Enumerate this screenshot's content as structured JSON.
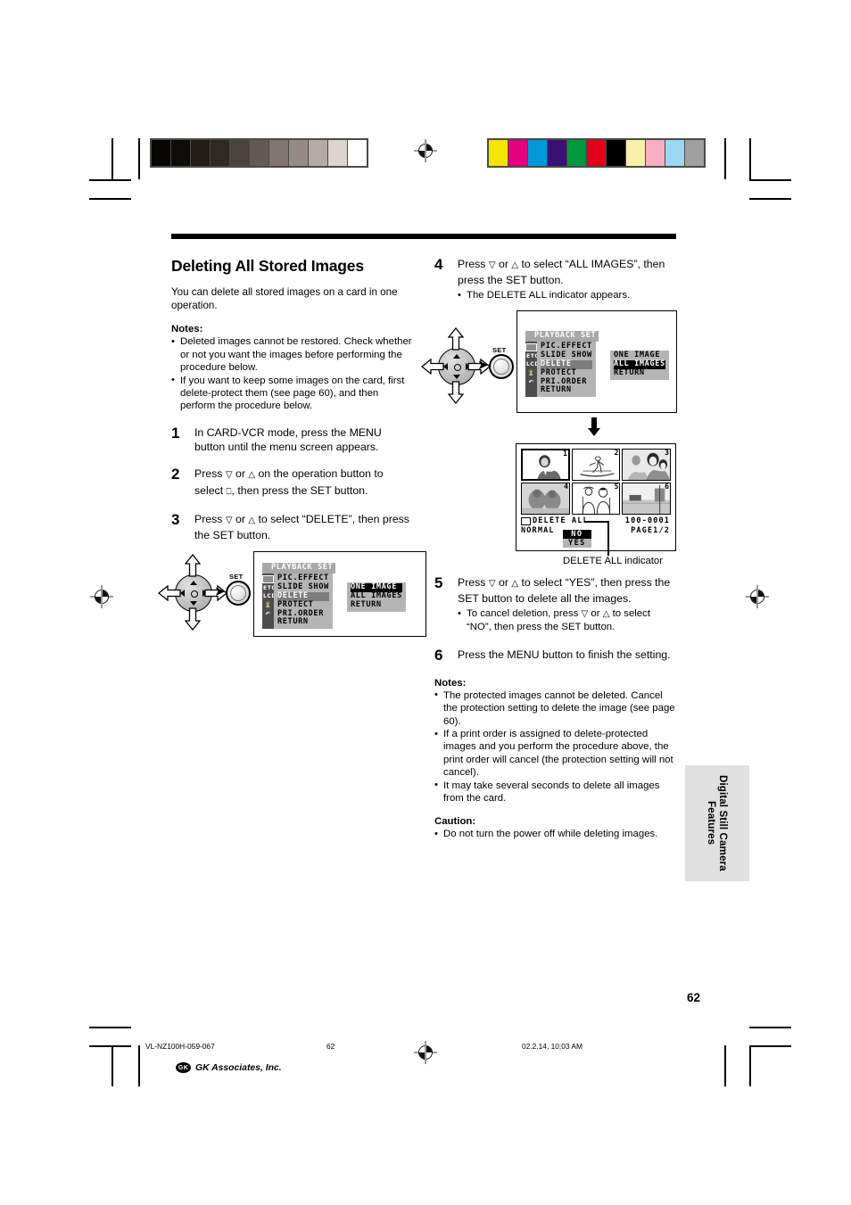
{
  "document": {
    "page_number": "62",
    "side_tab": "Digital Still Camera Features"
  },
  "section": {
    "title": "Deleting All Stored Images",
    "lead": "You can delete all stored images on a card in one operation."
  },
  "intro_notes": {
    "heading": "Notes:",
    "items": [
      "Deleted images cannot be restored. Check whether or not you want the images before performing the procedure below.",
      "If you want to keep some images on the card, first delete-protect them (see page 60), and then perform the procedure below."
    ]
  },
  "steps": [
    {
      "num": "1",
      "text": "In CARD-VCR mode, press the MENU button until the menu screen appears."
    },
    {
      "num": "2",
      "text_a": "Press ",
      "text_b": " or ",
      "text_c": " on the operation button to select ",
      "text_d": ", then press the SET button."
    },
    {
      "num": "3",
      "text_a": "Press ",
      "text_b": " or ",
      "text_c": " to select “DELETE”, then press the SET button."
    },
    {
      "num": "4",
      "text_a": "Press ",
      "text_b": " or ",
      "text_c": " to select “ALL IMAGES”, then press the SET button.",
      "sub": "The DELETE ALL indicator appears."
    },
    {
      "num": "5",
      "text_a": "Press ",
      "text_b": " or ",
      "text_c": " to select “YES”, then press the SET button to delete all the images.",
      "sub_a": "To cancel deletion, press ",
      "sub_b": " or ",
      "sub_c": " to select “NO”, then press the SET button."
    },
    {
      "num": "6",
      "text": "Press the MENU button to finish the setting."
    }
  ],
  "final_notes": {
    "heading": "Notes:",
    "items": [
      "The protected images cannot be deleted. Cancel the protection setting to delete the image (see page 60).",
      "If a print order is assigned to delete-protected images and you perform the procedure above, the print order will cancel (the protection setting will not cancel).",
      "It may take several seconds to delete all images from the card."
    ]
  },
  "caution": {
    "heading": "Caution:",
    "items": [
      "Do not turn the power off while deleting images."
    ]
  },
  "menu_screen": {
    "title": "PLAYBACK SET",
    "icons": [
      "card-icon",
      "ETC",
      "LCD",
      "clock-icon",
      "return-icon"
    ],
    "items": [
      "PIC.EFFECT",
      "SLIDE SHOW",
      "DELETE",
      "PROTECT",
      "PRI.ORDER",
      "RETURN"
    ],
    "highlighted_item": "DELETE",
    "submenu": [
      "ONE IMAGE",
      "ALL IMAGES",
      "RETURN"
    ],
    "submenu_highlight_step3": "ONE IMAGE",
    "submenu_highlight_step4": "ALL IMAGES",
    "set_label": "SET"
  },
  "thumbnail_screen": {
    "numbers": [
      "1",
      "2",
      "3",
      "4",
      "5",
      "6"
    ],
    "selected_index": 1,
    "osd_delete_all": "DELETE ALL",
    "osd_mode": "NORMAL",
    "osd_file": "100-0001",
    "osd_page": "PAGE1/2",
    "dialog": {
      "no": "NO",
      "yes": "YES",
      "highlighted": "NO"
    },
    "caption": "DELETE ALL indicator"
  },
  "footer": {
    "file_id": "VL-NZ100H-059-067",
    "page": "62",
    "timestamp": "02.2.14, 10:03 AM",
    "logo_mark": "GK",
    "logo_text": "GK Associates, Inc."
  },
  "colorbars": {
    "gray_wedge": [
      "#090606",
      "#0e0b09",
      "#231d1a",
      "#2f2926",
      "#4b433e",
      "#635a54",
      "#807570",
      "#968b86",
      "#b4aba6",
      "#dcd6d0",
      "#ffffff"
    ],
    "color_patches": [
      "#f2e500",
      "#e5007e",
      "#0098d8",
      "#3b1075",
      "#00983a",
      "#e2001a",
      "#000000",
      "#f8f0a8",
      "#f5aec4",
      "#9ed7f2",
      "#9f9f9f"
    ]
  }
}
